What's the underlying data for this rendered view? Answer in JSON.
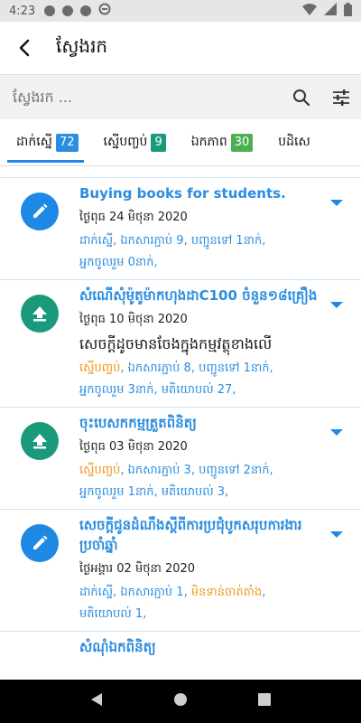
{
  "status_bar": {
    "time": "4:23"
  },
  "app_bar": {
    "title": "ស្វែងរក"
  },
  "search": {
    "placeholder": "ស្វែងរក ..."
  },
  "tabs": [
    {
      "label": "ដាក់ស្នើ",
      "count": "72",
      "badge_color": "#2b8de0",
      "active": true
    },
    {
      "label": "ស្នើបញ្ចប់",
      "count": "9",
      "badge_color": "#1a9a7a",
      "active": false
    },
    {
      "label": "ឯកភាព",
      "count": "30",
      "badge_color": "#4caf50",
      "active": false
    },
    {
      "label": "បដិសេ",
      "count": "",
      "badge_color": "",
      "active": false
    }
  ],
  "items": [
    {
      "icon": "pencil-icon",
      "icon_color": "#1e88e5",
      "title": "Buying books for students.",
      "date": "ថ្ងៃពុធ 24 មិថុនា 2020",
      "note": "",
      "meta_status": "ដាក់ស្នើ",
      "meta_rest": ", ឯកសារភ្ជាប់ 9, បញ្ជូនទៅ 1នាក់,",
      "meta_line2": "អ្នកចូលរួម 0នាក់,"
    },
    {
      "icon": "upload-icon",
      "icon_color": "#1a9a7a",
      "title": "សំណើសុំម៉ូតូម៉ាកហុងដាC100 ចំនួន១៨គ្រឿង",
      "date": "ថ្ងៃពុធ 10 មិថុនា 2020",
      "note": "សេចក្ដីដូចមានចែងក្នុងកម្មវត្ថុខាងលើ",
      "meta_status": "ស្នើបញ្ចប់",
      "meta_rest": ", ឯកសារភ្ជាប់ 8, បញ្ជូនទៅ 1នាក់,",
      "meta_line2": "អ្នកចូលរួម 3នាក់, មតិយោបល់ 27,"
    },
    {
      "icon": "upload-icon",
      "icon_color": "#1a9a7a",
      "title": "ចុះបេសកកម្មត្រួតពិនិត្យ",
      "date": "ថ្ងៃពុធ 03 មិថុនា 2020",
      "note": "",
      "meta_status": "ស្នើបញ្ចប់",
      "meta_rest": ", ឯកសារភ្ជាប់ 3, បញ្ជូនទៅ 2នាក់,",
      "meta_line2": "អ្នកចូលរួម 1នាក់, មតិយោបល់ 3,"
    },
    {
      "icon": "pencil-icon",
      "icon_color": "#1e88e5",
      "title": "សេចក្ដីជូនដំណឹងស្ដីពីការប្រជុំបូកសរុបការងារប្រចាំឆ្នាំ",
      "date": "ថ្ងៃអង្គារ 02 មិថុនា 2020",
      "note": "",
      "meta_status": "ដាក់ស្នើ",
      "meta_rest": ", ឯកសារភ្ជាប់ 1, ",
      "meta_extra": "មិនទាន់ចាត់តាំង",
      "meta_line2": "មតិយោបល់ 1,"
    },
    {
      "icon": "",
      "icon_color": "",
      "title": "សំណុំឯកពិនិត្យ",
      "date": "",
      "note": "",
      "meta_status": "",
      "meta_rest": "",
      "meta_line2": ""
    }
  ],
  "colors": {
    "accent": "#1e88e5",
    "teal": "#1a9a7a",
    "orange": "#f0961a"
  }
}
